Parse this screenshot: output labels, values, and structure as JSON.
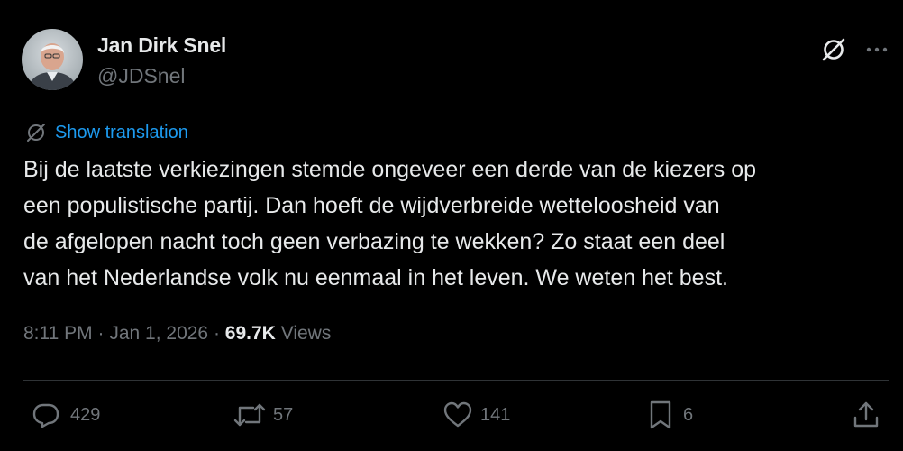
{
  "author": {
    "display_name": "Jan Dirk Snel",
    "handle": "@JDSnel"
  },
  "header": {
    "grok_icon": "slash-circle-icon",
    "more_icon": "ellipsis-icon"
  },
  "translation": {
    "icon": "translate-globe-icon",
    "label": "Show translation"
  },
  "tweet": {
    "lines": [
      "Bij de laatste verkiezingen stemde ongeveer een derde van de kiezers op",
      "een populistische partij. Dan hoeft de wijdverbreide wetteloosheid van",
      "de afgelopen nacht toch geen verbazing te wekken? Zo staat een deel",
      "van het Nederlandse volk nu eenmaal in het leven. We weten het best."
    ]
  },
  "meta": {
    "time": "8:11 PM",
    "separator": "·",
    "date": "Jan 1, 2026",
    "views_count": "69.7K",
    "views_label": "Views"
  },
  "actions": {
    "replies": {
      "icon": "reply-icon",
      "count": "429"
    },
    "reposts": {
      "icon": "repost-icon",
      "count": "57"
    },
    "likes": {
      "icon": "heart-icon",
      "count": "141"
    },
    "bookmarks": {
      "icon": "bookmark-icon",
      "count": "6"
    },
    "share": {
      "icon": "share-icon"
    }
  },
  "colors": {
    "background": "#000000",
    "primary_text": "#e7e9ea",
    "secondary_text": "#71767b",
    "link": "#1d9bf0",
    "divider": "#2f3336"
  }
}
